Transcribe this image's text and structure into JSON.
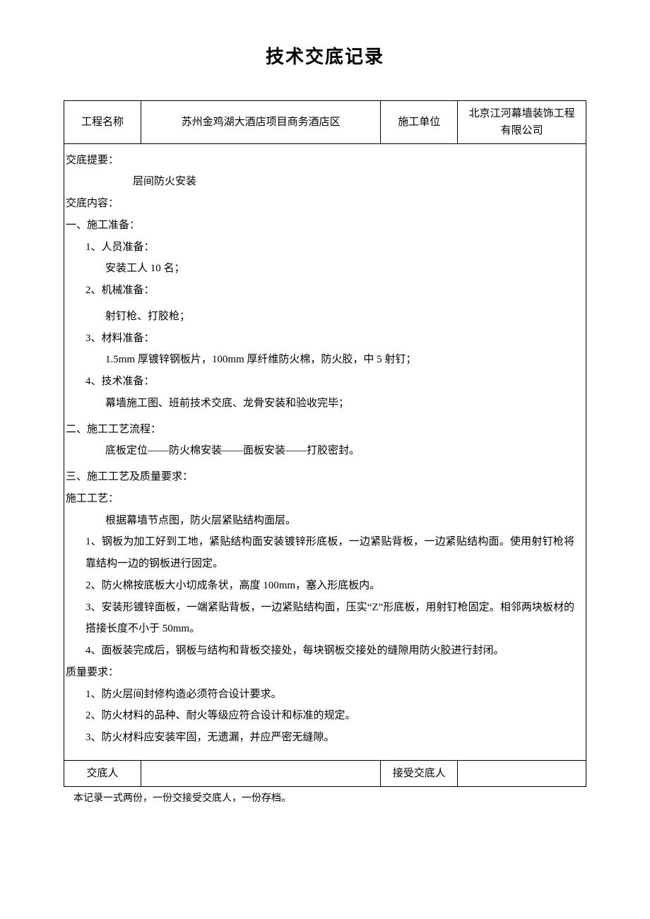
{
  "title": "技术交底记录",
  "header": {
    "project_label": "工程名称",
    "project_value": "苏州金鸡湖大酒店项目商务酒店区",
    "unit_label": "施工单位",
    "unit_value": "北京江河幕墙装饰工程有限公司"
  },
  "summary_label": "交底提要：",
  "summary_value": "层间防火安装",
  "content_label": "交底内容：",
  "section1": {
    "heading": "一、施工准备：",
    "item1": "1、人员准备：",
    "item1_detail": "安装工人 10 名；",
    "item2": "2、机械准备：",
    "item2_detail": "射钉枪、打胶枪；",
    "item3": "3、材料准备：",
    "item3_detail": "1.5mm 厚镀锌钢板片，100mm 厚纤维防火棉，防火胶，中 5 射钉；",
    "item4": "4、技术准备：",
    "item4_detail": "幕墙施工图、班前技术交底、龙骨安装和验收完毕；"
  },
  "section2": {
    "heading": "二、施工工艺流程：",
    "detail": "底板定位——防火棉安装——面板安装——打胶密封。"
  },
  "section3": {
    "heading": "三、施工工艺及质量要求：",
    "sub1_label": "施工工艺：",
    "sub1_intro": "根据幕墙节点图，防火层紧贴结构面层。",
    "sub1_item1": "1、钢板为加工好到工地，紧贴结构面安装镀锌形底板，一边紧贴背板，一边紧贴结构面。使用射钉枪将靠结构一边的钢板进行固定。",
    "sub1_item2": "2、防火棉按底板大小切成条状，高度 100mm，塞入形底板内。",
    "sub1_item3": "3、安装形镀锌面板，一端紧贴背板，一边紧贴结构面，压实“Z”形底板，用射钉枪固定。相邻两块板材的搭接长度不小于 50mm。",
    "sub1_item4": "4、面板装完成后，钢板与结构和背板交接处，每块钢板交接处的缝隙用防火胶进行封闭。",
    "sub2_label": "质量要求：",
    "sub2_item1": "1、防火层间封修构造必须符合设计要求。",
    "sub2_item2": "2、防火材料的品种、耐火等级应符合设计和标准的规定。",
    "sub2_item3": "3、防火材料应安装牢固，无遗漏，并应严密无缝隙。"
  },
  "footer_row": {
    "giver_label": "交底人",
    "giver_value": "",
    "receiver_label": "接受交底人",
    "receiver_value": ""
  },
  "footer_note": "本记录一式两份，一份交接受交底人，一份存档。"
}
